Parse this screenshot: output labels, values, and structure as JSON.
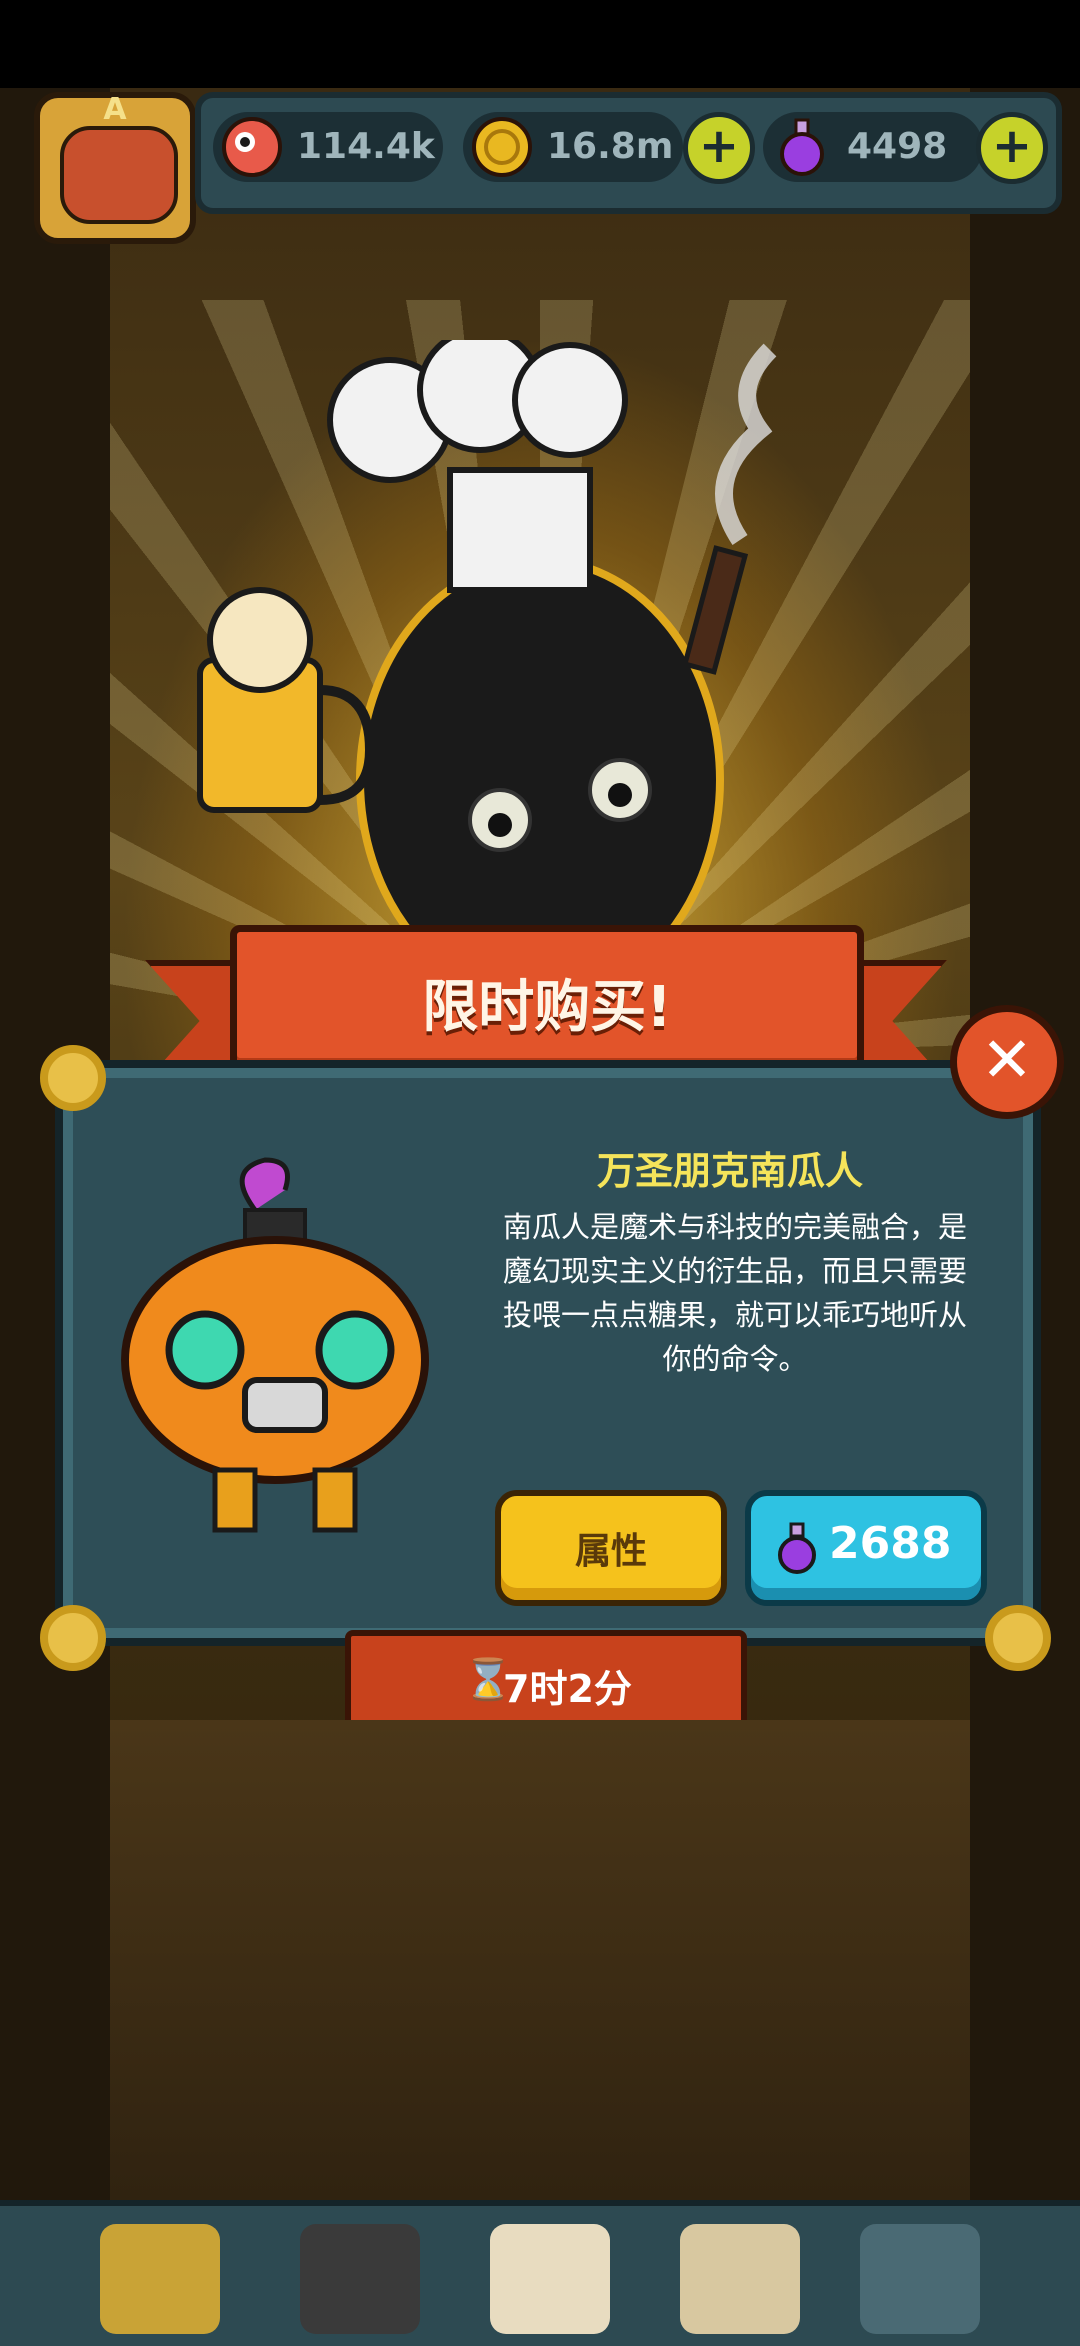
{
  "resources": {
    "eyeballs": "114.4k",
    "coins": "16.8m",
    "potions": "4498"
  },
  "profile": {
    "letter": "A"
  },
  "offer": {
    "banner_title": "限时购买!",
    "item_name": "万圣朋克南瓜人",
    "description": "南瓜人是魔术与科技的完美融合，是魔幻现实主义的衍生品，而且只需要投喂一点点糖果，就可以乖巧地听从你的命令。",
    "attributes_label": "属性",
    "price": "2688",
    "timer_icon": "⌛",
    "timer": "7时2分"
  },
  "icons": {
    "eyeball": "eyeball-icon",
    "coin": "coin-icon",
    "potion": "potion-icon",
    "close": "close-icon",
    "hourglass": "hourglass-icon"
  },
  "colors": {
    "banner": "#e2542a",
    "panel": "#2e4e57",
    "title_yellow": "#f5e45a",
    "attr_button": "#f5c21c",
    "price_button": "#2ec2e2"
  }
}
